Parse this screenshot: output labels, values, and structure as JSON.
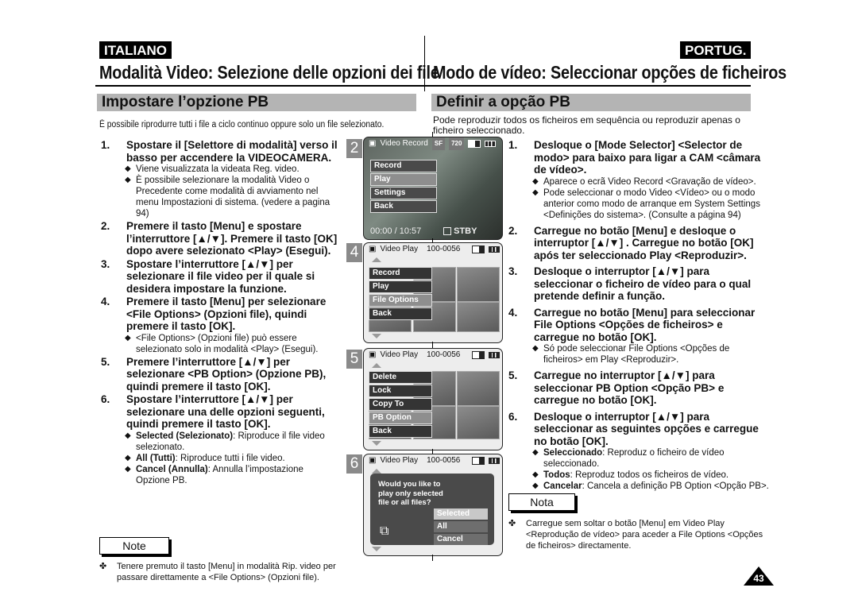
{
  "left": {
    "lang": "ITALIANO",
    "title": "Modalità Video: Selezione delle opzioni dei file",
    "section": "Impostare l’opzione PB",
    "intro": "È possibile riprodurre tutti i file a ciclo continuo oppure solo un file selezionato.",
    "steps": [
      {
        "num": "1.",
        "text": "Spostare il [Selettore di modalità] verso il basso per accendere la VIDEOCAMERA.",
        "bullets": [
          {
            "bold": "",
            "text": "Viene visualizzata la videata Reg. video."
          },
          {
            "bold": "",
            "text": "È possibile selezionare la modalità Video  o Precedente come modalità di avviamento nel menu Impostazioni di sistema. (vedere a pagina 94)"
          }
        ]
      },
      {
        "num": "2.",
        "text": "Premere il tasto [Menu] e spostare l’interruttore [▲/▼]. Premere il tasto [OK] dopo avere selezionato <Play> (Esegui).",
        "bullets": []
      },
      {
        "num": "3.",
        "text": "Spostare l’interruttore [▲/▼] per selezionare il file video per il quale si desidera impostare la funzione.",
        "bullets": []
      },
      {
        "num": "4.",
        "text": "Premere il tasto [Menu] per selezionare <File Options> (Opzioni file), quindi premere il tasto [OK].",
        "bullets": [
          {
            "bold": "",
            "text": "<File Options> (Opzioni file) può essere selezionato solo in modalità <Play> (Esegui)."
          }
        ]
      },
      {
        "num": "5.",
        "text": " Premere l’interruttore [▲/▼]  per selezionare <PB Option> (Opzione PB), quindi premere il tasto [OK].",
        "bullets": []
      },
      {
        "num": "6.",
        "text": "Spostare l’interruttore [▲/▼] per selezionare una delle opzioni seguenti, quindi premere il tasto [OK].",
        "bullets": [
          {
            "bold": "Selected (Selezionato)",
            "text": ": Riproduce il file video selezionato."
          },
          {
            "bold": "All (Tutti)",
            "text": ": Riproduce tutti i file video."
          },
          {
            "bold": "Cancel (Annulla)",
            "text": ": Annulla l’impostazione Opzione PB."
          }
        ]
      }
    ],
    "note_label": "Note",
    "note_bullet": "✤",
    "note_text": "Tenere premuto il tasto [Menu] in modalità Rip. video per passare direttamente a <File Options> (Opzioni file)."
  },
  "right": {
    "lang": "PORTUG.",
    "title": "Modo de vídeo: Seleccionar opções de ficheiros",
    "section": "Definir a opção PB",
    "intro": "Pode reproduzir todos os ficheiros em sequência ou reproduzir apenas o ficheiro seleccionado.",
    "steps": [
      {
        "num": "1.",
        "text": "Desloque o [Mode Selector] <Selector de modo> para baixo para ligar a CAM <câmara de vídeo>.",
        "bullets": [
          {
            "bold": "",
            "text": "Aparece o ecrã Video Record <Gravação de vídeo>."
          },
          {
            "bold": "",
            "text": "Pode seleccionar o modo Video <Vídeo> ou o modo anterior como modo de arranque em System Settings <Definições do sistema>. (Consulte a página 94)"
          }
        ]
      },
      {
        "num": "2.",
        "text": "Carregue no botão [Menu] e desloque o interruptor [▲/▼] . Carregue no botão [OK] após ter seleccionado Play <Reproduzir>.",
        "bullets": []
      },
      {
        "num": "3.",
        "text": "Desloque o interruptor [▲/▼] para seleccionar o ficheiro de vídeo para o qual pretende definir a função.",
        "bullets": []
      },
      {
        "num": "4.",
        "text": "Carregue no botão [Menu] para seleccionar File Options <Opções de ficheiros> e carregue no botão [OK].",
        "bullets": [
          {
            "bold": "",
            "text": "Só pode seleccionar File Options <Opções de ficheiros> em Play <Reproduzir>."
          }
        ]
      },
      {
        "num": "5.",
        "text": "Carregue no interruptor [▲/▼] para seleccionar PB Option <Opção PB> e carregue no botão [OK].",
        "bullets": []
      },
      {
        "num": "6.",
        "text": "Desloque o interruptor [▲/▼] para seleccionar as seguintes opções e carregue no botão [OK].",
        "bullets": [
          {
            "bold": "Seleccionado",
            "text": ": Reproduz o ficheiro de vídeo seleccionado."
          },
          {
            "bold": "Todos",
            "text": ": Reproduz todos os ficheiros de vídeo."
          },
          {
            "bold": "Cancelar",
            "text": ": Cancela a definição PB Option <Opção PB>."
          }
        ]
      }
    ],
    "note_label": "Nota",
    "note_bullet": "✤",
    "note_text": "Carregue sem soltar o botão [Menu] em Video Play <Reprodução de vídeo> para aceder a File Options <Opções de ficheiros> directamente."
  },
  "panels": [
    {
      "num": "2",
      "mode": "Video Record",
      "badge1": "SF",
      "badge2": "720",
      "menu": [
        "Record",
        "Play",
        "Settings",
        "Back"
      ],
      "selected": 1,
      "time": "00:00 / 10:57",
      "status": "STBY"
    },
    {
      "num": "4",
      "mode": "Video Play",
      "file": "100-0056",
      "menu": [
        "Record",
        "Play",
        "File Options",
        "Back"
      ],
      "selected": 2
    },
    {
      "num": "5",
      "mode": "Video Play",
      "file": "100-0056",
      "menu": [
        "Delete",
        "Lock",
        "Copy To",
        "PB Option",
        "Back"
      ],
      "selected": 3
    },
    {
      "num": "6",
      "mode": "Video Play",
      "file": "100-0056",
      "dialog": "Would you like to play only selected file or all files?",
      "options": [
        "Selected",
        "All",
        "Cancel"
      ],
      "selected": 0
    }
  ],
  "page_number": "43"
}
